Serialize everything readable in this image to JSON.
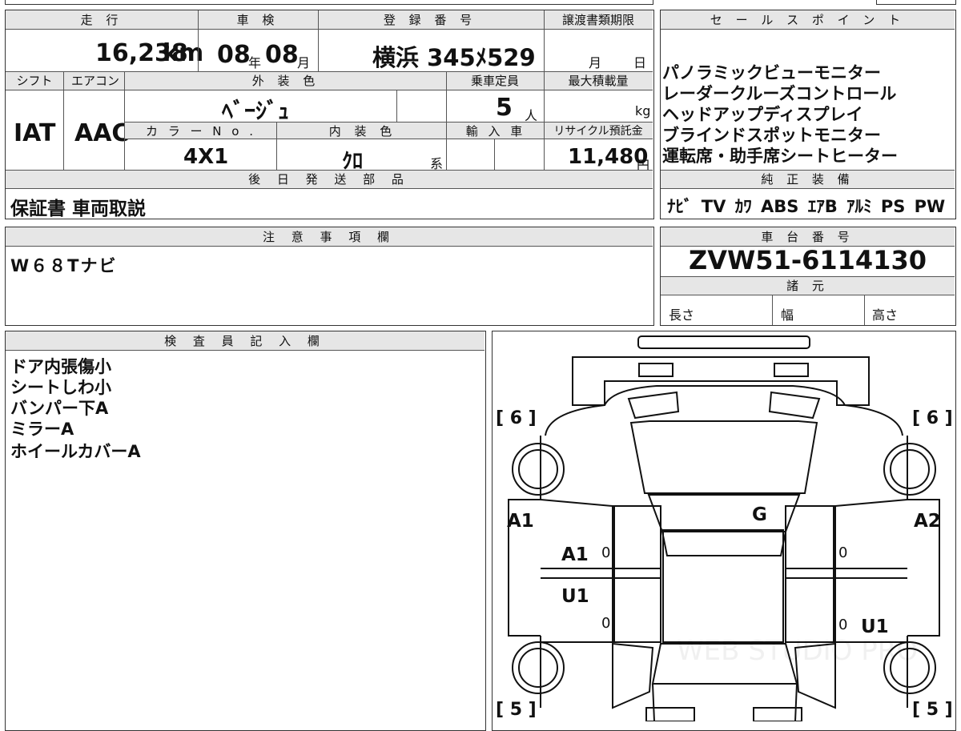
{
  "top": {
    "mileage_hdr": "走 行",
    "shaken_hdr": "車 検",
    "regno_hdr": "登 録 番 号",
    "transfer_hdr": "譲渡書類期限",
    "mileage": "16,238",
    "mileage_unit": "km",
    "shaken_year": "08",
    "shaken_year_unit": "年",
    "shaken_month": "08",
    "shaken_month_unit": "月",
    "regno": "横浜 345ﾒ529",
    "transfer_month_unit": "月",
    "transfer_day_unit": "日",
    "shift_hdr": "シフト",
    "ac_hdr": "エアコン",
    "exterior_hdr": "外 装 色",
    "capacity_hdr": "乗車定員",
    "maxload_hdr": "最大積載量",
    "shift": "IAT",
    "ac": "AAC",
    "exterior_color": "ﾍﾞｰｼﾞｭ",
    "capacity": "5",
    "capacity_unit": "人",
    "maxload_unit": "kg",
    "colorno_hdr": "カ ラ ー N o .",
    "interior_hdr": "内 装 色",
    "import_hdr": "輸 入 車",
    "recycle_hdr": "リサイクル預託金",
    "color_no": "4X1",
    "interior_color": "ｸﾛ",
    "interior_suffix": "系",
    "recycle_fee": "11,480",
    "recycle_unit": "円",
    "later_parts_hdr": "後 日 発 送 部 品",
    "later_parts": "保証書 車両取説"
  },
  "sales": {
    "hdr": "セ ー ル ス ポ イ ン ト",
    "points": [
      "パノラミックビューモニター",
      "レーダークルーズコントロール",
      "ヘッドアップディスプレイ",
      "ブラインドスポットモニター",
      "運転席・助手席シートヒーター"
    ],
    "equip_hdr": "純 正 装 備",
    "equipment": "ﾅﾋﾞ TV ｶﾜ ABS ｴｱB ｱﾙﾐ PS PW"
  },
  "notes": {
    "hdr": "注 意 事 項 欄",
    "text": "W６８Tナビ"
  },
  "chassis": {
    "hdr": "車 台 番 号",
    "number": "ZVW51-6114130",
    "specs_hdr": "諸 元",
    "length": "長さ",
    "width": "幅",
    "height": "高さ"
  },
  "inspector": {
    "hdr": "検 査 員 記 入 欄",
    "lines": [
      "ドア内張傷小",
      "シートしわ小",
      "バンパー下A",
      "ミラーA",
      "ホイールカバーA"
    ]
  },
  "diagram": {
    "tire_fl": "[ 6 ]",
    "tire_fr": "[ 6 ]",
    "tire_rl": "[ 5 ]",
    "tire_rr": "[ 5 ]",
    "mark_left_fender": "A1",
    "mark_right_fender": "A2",
    "mark_roof": "G",
    "mark_front_door_left": "A1",
    "mark_rear_door_left": "U1",
    "mark_rear_door_right": "U1",
    "zero": "0",
    "watermark": "WEB STUDIO PRO"
  }
}
